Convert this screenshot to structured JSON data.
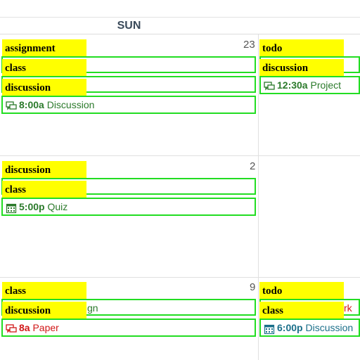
{
  "header": {
    "day": "SUN"
  },
  "weeks": [
    {
      "day_num": "23",
      "labels": [
        "assignment",
        "class",
        "discussion"
      ],
      "event": {
        "time": "8:00a",
        "title": "Discussion",
        "icon": "discussion-icon"
      },
      "right": {
        "labels": [
          "todo",
          "discussion"
        ],
        "event": {
          "time": "12:30a",
          "title": "Project",
          "icon": "discussion-icon"
        }
      }
    },
    {
      "day_num": "2",
      "labels": [
        "discussion",
        "class"
      ],
      "event": {
        "time": "5:00p",
        "title": "Quiz",
        "icon": "calendar-icon"
      }
    },
    {
      "day_num": "9",
      "labels": [
        "class",
        "discussion"
      ],
      "hidden_text": "gn",
      "event": {
        "time": "8a",
        "title": "Paper",
        "icon": "discussion-icon"
      },
      "right": {
        "labels": [
          "todo",
          "class"
        ],
        "hidden_text": "rk",
        "event": {
          "time": "6:00p",
          "title": "Discussion",
          "icon": "calendar-icon"
        }
      }
    }
  ],
  "colors": {
    "highlight": "#ffff00",
    "outline": "#22dd22",
    "green": "#2b7a2b",
    "red": "#d11818",
    "teal": "#1a6f8a"
  }
}
